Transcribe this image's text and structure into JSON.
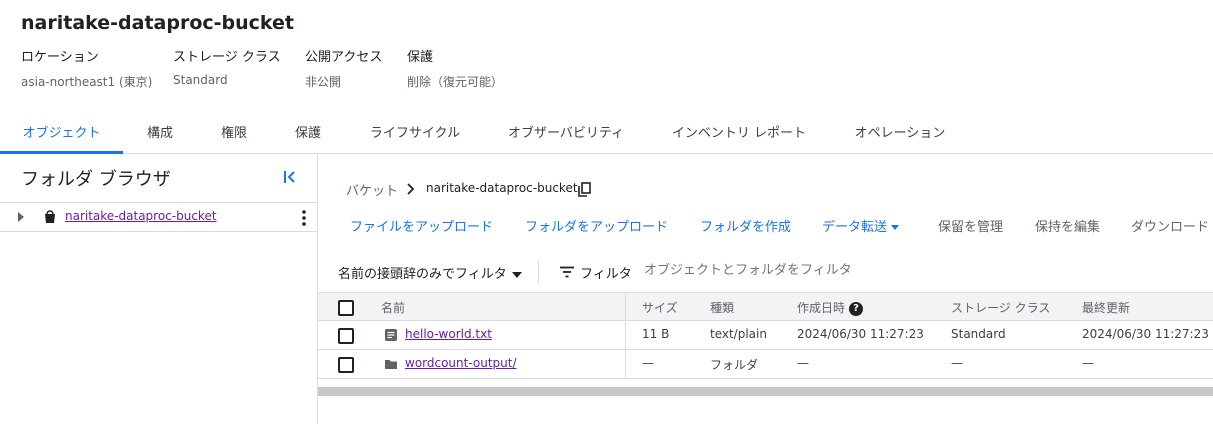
{
  "bucket": {
    "title": "naritake-dataproc-bucket",
    "meta": [
      {
        "label": "ロケーション",
        "value": "asia-northeast1 (東京)"
      },
      {
        "label": "ストレージ クラス",
        "value": "Standard"
      },
      {
        "label": "公開アクセス",
        "value": "非公開"
      },
      {
        "label": "保護",
        "value": "削除（復元可能）"
      }
    ]
  },
  "tabs": [
    {
      "label": "オブジェクト",
      "active": true
    },
    {
      "label": "構成"
    },
    {
      "label": "権限"
    },
    {
      "label": "保護"
    },
    {
      "label": "ライフサイクル"
    },
    {
      "label": "オブザーバビリティ"
    },
    {
      "label": "インベントリ レポート"
    },
    {
      "label": "オペレーション"
    }
  ],
  "folder_browser": {
    "title": "フォルダ ブラウザ",
    "tree": [
      {
        "label": "naritake-dataproc-bucket"
      }
    ]
  },
  "breadcrumb": {
    "root": "バケット",
    "bucket": "naritake-dataproc-bucket"
  },
  "actions": [
    {
      "label": "ファイルをアップロード"
    },
    {
      "label": "フォルダをアップロード"
    },
    {
      "label": "フォルダを作成"
    },
    {
      "label": "データ転送"
    },
    {
      "label": "保留を管理"
    },
    {
      "label": "保持を編集"
    },
    {
      "label": "ダウンロード"
    }
  ],
  "filter": {
    "prefix_label": "名前の接頭辞のみでフィルタ",
    "filter_label": "フィルタ",
    "placeholder": "オブジェクトとフォルダをフィルタ"
  },
  "table": {
    "headers": [
      "名前",
      "サイズ",
      "種類",
      "作成日時",
      "ストレージ クラス",
      "最終更新"
    ],
    "rows": [
      {
        "icon": "file-icon",
        "name": "hello-world.txt",
        "size": "11 B",
        "type": "text/plain",
        "created": "2024/06/30 11:27:23",
        "storage_class": "Standard",
        "updated": "2024/06/30 11:27:23"
      },
      {
        "icon": "folder-icon",
        "name": "wordcount-output/",
        "size": "—",
        "type": "フォルダ",
        "created": "—",
        "storage_class": "—",
        "updated": "—"
      }
    ]
  },
  "colors": {
    "accent": "#1a73e8",
    "visited_link": "#681da8"
  }
}
